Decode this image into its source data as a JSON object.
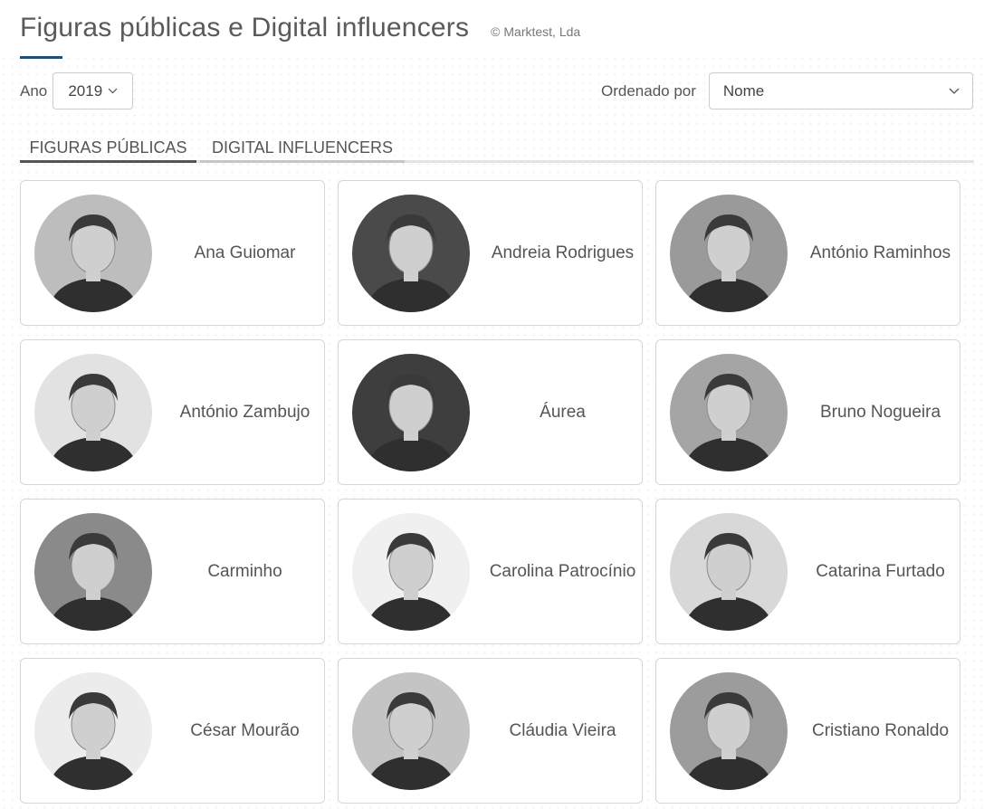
{
  "header": {
    "title": "Figuras públicas e Digital influencers",
    "copyright": "© Marktest, Lda"
  },
  "filters": {
    "year_label": "Ano",
    "year_value": "2019",
    "order_label": "Ordenado por",
    "order_value": "Nome"
  },
  "tabs": [
    {
      "label": "FIGURAS PÚBLICAS",
      "active": true
    },
    {
      "label": "DIGITAL INFLUENCERS",
      "active": false
    }
  ],
  "people": [
    {
      "name": "Ana Guiomar",
      "tone": "#bdbdbd"
    },
    {
      "name": "Andreia Rodrigues",
      "tone": "#4a4a4a"
    },
    {
      "name": "António Raminhos",
      "tone": "#9a9a9a"
    },
    {
      "name": "António Zambujo",
      "tone": "#e2e2e2"
    },
    {
      "name": "Áurea",
      "tone": "#3e3e3e"
    },
    {
      "name": "Bruno Nogueira",
      "tone": "#a5a5a5"
    },
    {
      "name": "Carminho",
      "tone": "#8a8a8a"
    },
    {
      "name": "Carolina Patrocínio",
      "tone": "#f0f0f0"
    },
    {
      "name": "Catarina Furtado",
      "tone": "#d8d8d8"
    },
    {
      "name": "César Mourão",
      "tone": "#ececec"
    },
    {
      "name": "Cláudia Vieira",
      "tone": "#c4c4c4"
    },
    {
      "name": "Cristiano Ronaldo",
      "tone": "#9c9c9c"
    }
  ]
}
